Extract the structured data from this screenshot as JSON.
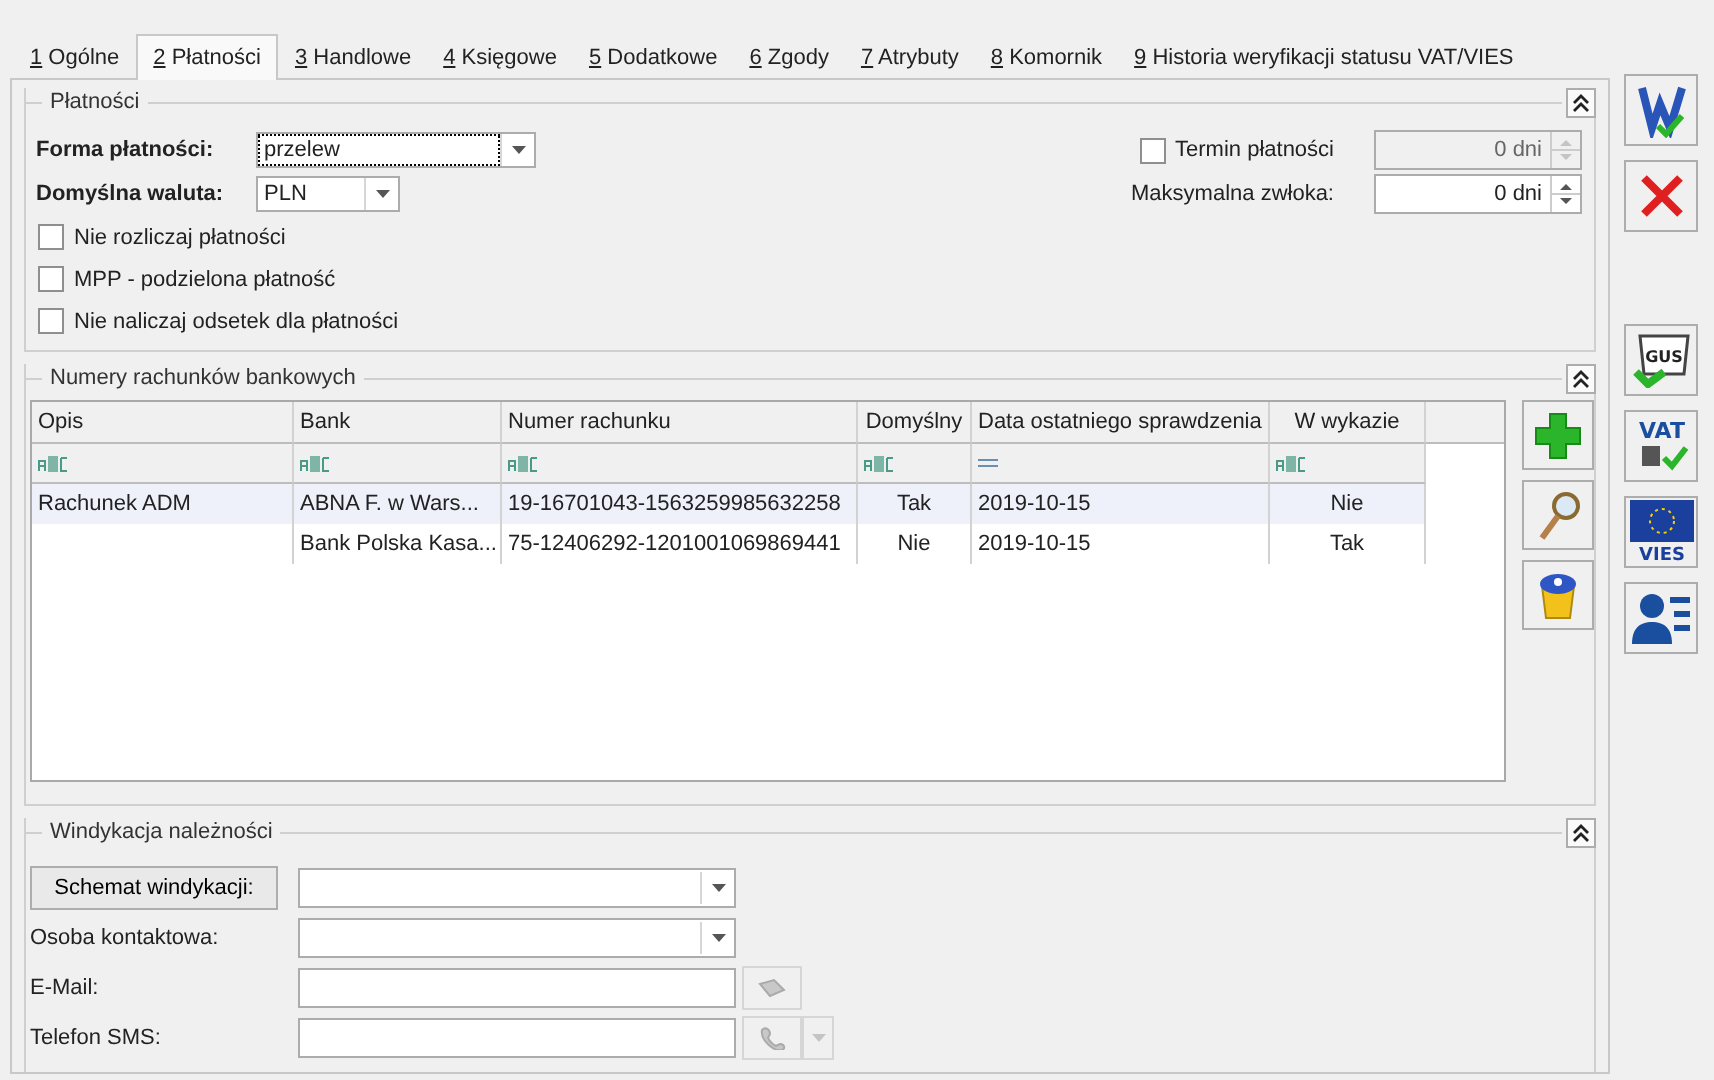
{
  "tabs": [
    {
      "key": "1",
      "label": "Ogólne",
      "selected": false
    },
    {
      "key": "2",
      "label": "Płatności",
      "selected": true
    },
    {
      "key": "3",
      "label": "Handlowe",
      "selected": false
    },
    {
      "key": "4",
      "label": "Księgowe",
      "selected": false
    },
    {
      "key": "5",
      "label": "Dodatkowe",
      "selected": false
    },
    {
      "key": "6",
      "label": "Zgody",
      "selected": false
    },
    {
      "key": "7",
      "label": "Atrybuty",
      "selected": false
    },
    {
      "key": "8",
      "label": "Komornik",
      "selected": false
    },
    {
      "key": "9",
      "label": "Historia weryfikacji statusu VAT/VIES",
      "selected": false
    }
  ],
  "payments": {
    "title": "Płatności",
    "form": {
      "label": "Forma płatności:",
      "value": "przelew"
    },
    "currency": {
      "label": "Domyślna waluta:",
      "value": "PLN"
    },
    "checkboxes": [
      {
        "label": "Nie rozliczaj płatności",
        "checked": false
      },
      {
        "label": "MPP - podzielona płatność",
        "checked": false
      },
      {
        "label": "Nie naliczaj odsetek dla płatności",
        "checked": false
      }
    ],
    "term": {
      "label": "Termin płatności",
      "checked": false,
      "value": "0 dni",
      "disabled": true
    },
    "delay": {
      "label": "Maksymalna zwłoka:",
      "value": "0 dni",
      "disabled": false
    }
  },
  "accounts": {
    "title": "Numery rachunków bankowych",
    "columns": [
      {
        "label": "Opis",
        "kind": "text"
      },
      {
        "label": "Bank",
        "kind": "text"
      },
      {
        "label": "Numer rachunku",
        "kind": "text"
      },
      {
        "label": "Domyślny",
        "kind": "text"
      },
      {
        "label": "Data ostatniego sprawdzenia",
        "kind": "date"
      },
      {
        "label": "W wykazie",
        "kind": "text"
      }
    ],
    "rows": [
      {
        "cells": [
          "Rachunek ADM",
          "ABNA F. w Wars...",
          "19-16701043-1563259985632258",
          "Tak",
          "2019-10-15",
          "Nie"
        ],
        "selected": true
      },
      {
        "cells": [
          "",
          "Bank Polska Kasa...",
          "75-12406292-1201001069869441",
          "Nie",
          "2019-10-15",
          "Tak"
        ],
        "selected": false
      }
    ],
    "actions": [
      {
        "kind": "add"
      },
      {
        "kind": "view"
      },
      {
        "kind": "delete"
      }
    ]
  },
  "collection": {
    "title": "Windykacja należności",
    "fields": [
      {
        "kind": "button-combo",
        "label": "Schemat windykacji:"
      },
      {
        "kind": "combo",
        "label": "Osoba kontaktowa:"
      },
      {
        "kind": "email",
        "label": "E-Mail:"
      },
      {
        "kind": "phone",
        "label": "Telefon SMS:"
      }
    ]
  },
  "toolbar": [
    {
      "kind": "save"
    },
    {
      "kind": "cancel"
    },
    {
      "kind": "gus",
      "text": "GUS"
    },
    {
      "kind": "vat",
      "text": "VAT"
    },
    {
      "kind": "vies",
      "text": "VIES"
    },
    {
      "kind": "person"
    }
  ]
}
